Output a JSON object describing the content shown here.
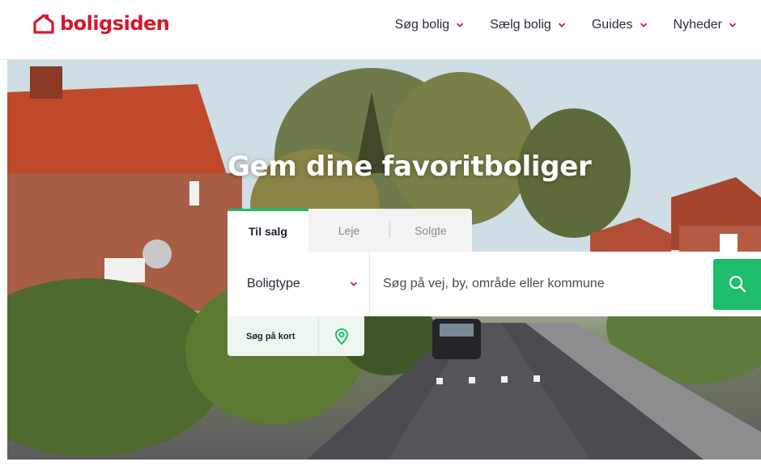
{
  "brand": {
    "name": "boligsiden",
    "color": "#d5172d",
    "accent": "#1ebd6b"
  },
  "header": {
    "nav": [
      {
        "label": "Søg bolig",
        "icon": "chevron-down-icon"
      },
      {
        "label": "Sælg bolig",
        "icon": "chevron-down-icon"
      },
      {
        "label": "Guides",
        "icon": "chevron-down-icon"
      },
      {
        "label": "Nyheder",
        "icon": "chevron-down-icon"
      }
    ]
  },
  "hero": {
    "title": "Gem dine favoritboliger",
    "tabs": [
      {
        "label": "Til salg",
        "active": true
      },
      {
        "label": "Leje",
        "active": false
      },
      {
        "label": "Solgte",
        "active": false
      }
    ],
    "search": {
      "property_type": "Boligtype",
      "placeholder": "Søg på vej, by, område eller kommune",
      "button_icon": "search-icon"
    },
    "map_button": {
      "label": "Søg på kort",
      "icon": "map-pin-icon"
    }
  }
}
